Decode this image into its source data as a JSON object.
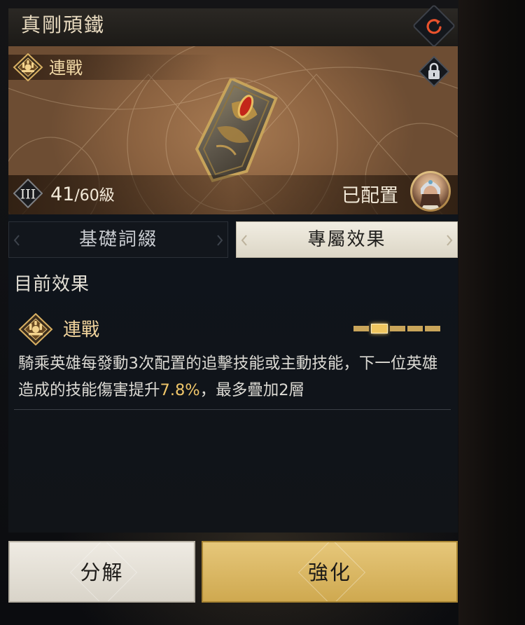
{
  "header": {
    "title": "真剛頑鐵"
  },
  "item": {
    "set_label": "連戰",
    "tier": "III",
    "level_current": "41",
    "level_max": "/60級",
    "status": "已配置"
  },
  "tabs": [
    {
      "label": "基礎詞綴",
      "selected": false
    },
    {
      "label": "專屬效果",
      "selected": true
    }
  ],
  "effects": {
    "section_title": "目前效果",
    "name": "連戰",
    "stage_total": 5,
    "stage_active": 2,
    "description_before": "騎乘英雄每發動3次配置的追擊技能或主動技能，下一位英雄造成的技能傷害提升",
    "description_value": "7.8%",
    "description_after": "，最多疊加2層"
  },
  "buttons": {
    "decompose": "分解",
    "enhance": "強化"
  },
  "colors": {
    "accent_gold": "#f0c66a",
    "enhance_button": "#d9b865",
    "selected_tab": "#ece8dd"
  }
}
